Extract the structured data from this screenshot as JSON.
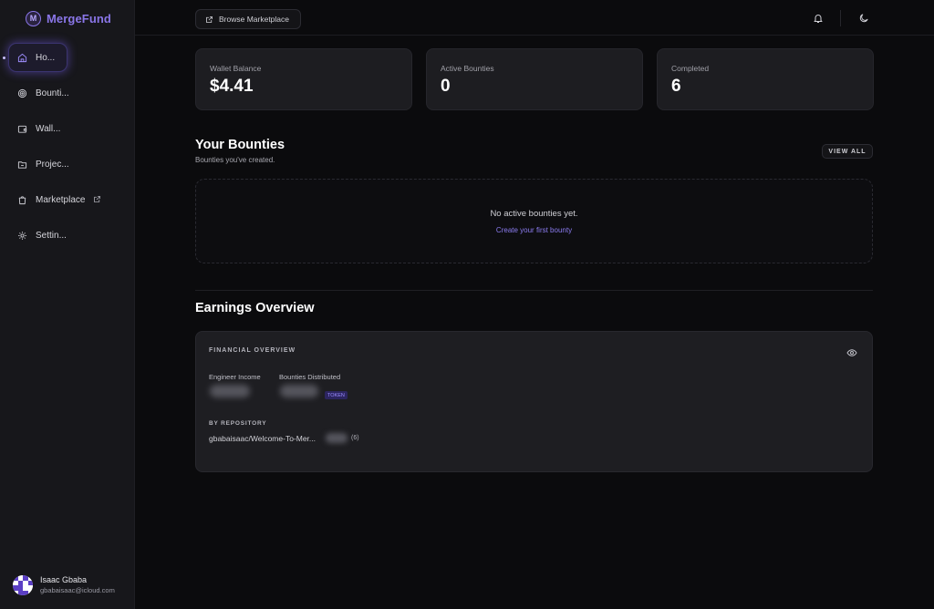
{
  "brand": {
    "logo_letter": "M",
    "name": "MergeFund",
    "accent": "#8a76e8"
  },
  "nav": {
    "items": [
      {
        "label": "Ho...",
        "icon": "home-icon",
        "active": true
      },
      {
        "label": "Bounti...",
        "icon": "target-icon"
      },
      {
        "label": "Wall...",
        "icon": "wallet-icon"
      },
      {
        "label": "Projec...",
        "icon": "folder-icon"
      },
      {
        "label": "Marketplace",
        "icon": "shopping-bag-icon",
        "external": true
      },
      {
        "label": "Settin...",
        "icon": "gear-icon"
      }
    ]
  },
  "user": {
    "name": "Isaac Gbaba",
    "email": "gbabaisaac@icloud.com"
  },
  "topbar": {
    "browse_label": "Browse Marketplace",
    "icons": [
      "bell-icon",
      "moon-icon"
    ]
  },
  "stats": [
    {
      "label": "Wallet Balance",
      "value": "$4.41"
    },
    {
      "label": "Active Bounties",
      "value": "0"
    },
    {
      "label": "Completed",
      "value": "6"
    }
  ],
  "bounties": {
    "title": "Your Bounties",
    "subtitle": "Bounties you've created.",
    "view_all": "VIEW ALL",
    "empty_text": "No active bounties yet.",
    "empty_link": "Create your first bounty"
  },
  "earnings": {
    "title": "Earnings Overview",
    "card_title": "FINANCIAL OVERVIEW",
    "engineer_income_label": "Engineer Income",
    "bounties_distributed_label": "Bounties Distributed",
    "token_badge": "TOKEN",
    "by_repo_title": "BY REPOSITORY",
    "repo_name": "gbabaisaac/Welcome-To-Mer...",
    "repo_count": "(6)"
  }
}
